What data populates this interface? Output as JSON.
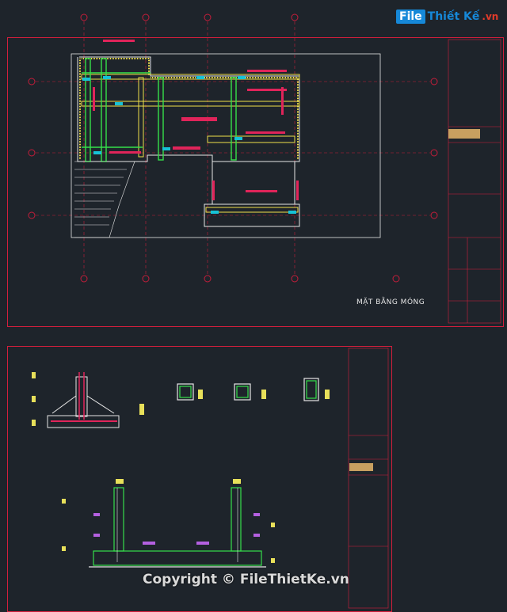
{
  "brand": {
    "logo_box": "File",
    "logo_rest": "Thiết Kế",
    "logo_suffix": ".vn"
  },
  "plan": {
    "title": "MẶT BẰNG MÓNG"
  },
  "watermark": "Copyright © FileThietKe.vn",
  "colors": {
    "background": "#1e242b",
    "frame": "#d21f3c",
    "wall": "#e6e6e6",
    "column": "#35e04a",
    "beam": "#f0e04a",
    "tag": "#16c2d6",
    "rebar": "#e0245a",
    "dim": "#e8e05a",
    "grid": "#c41d3a"
  }
}
